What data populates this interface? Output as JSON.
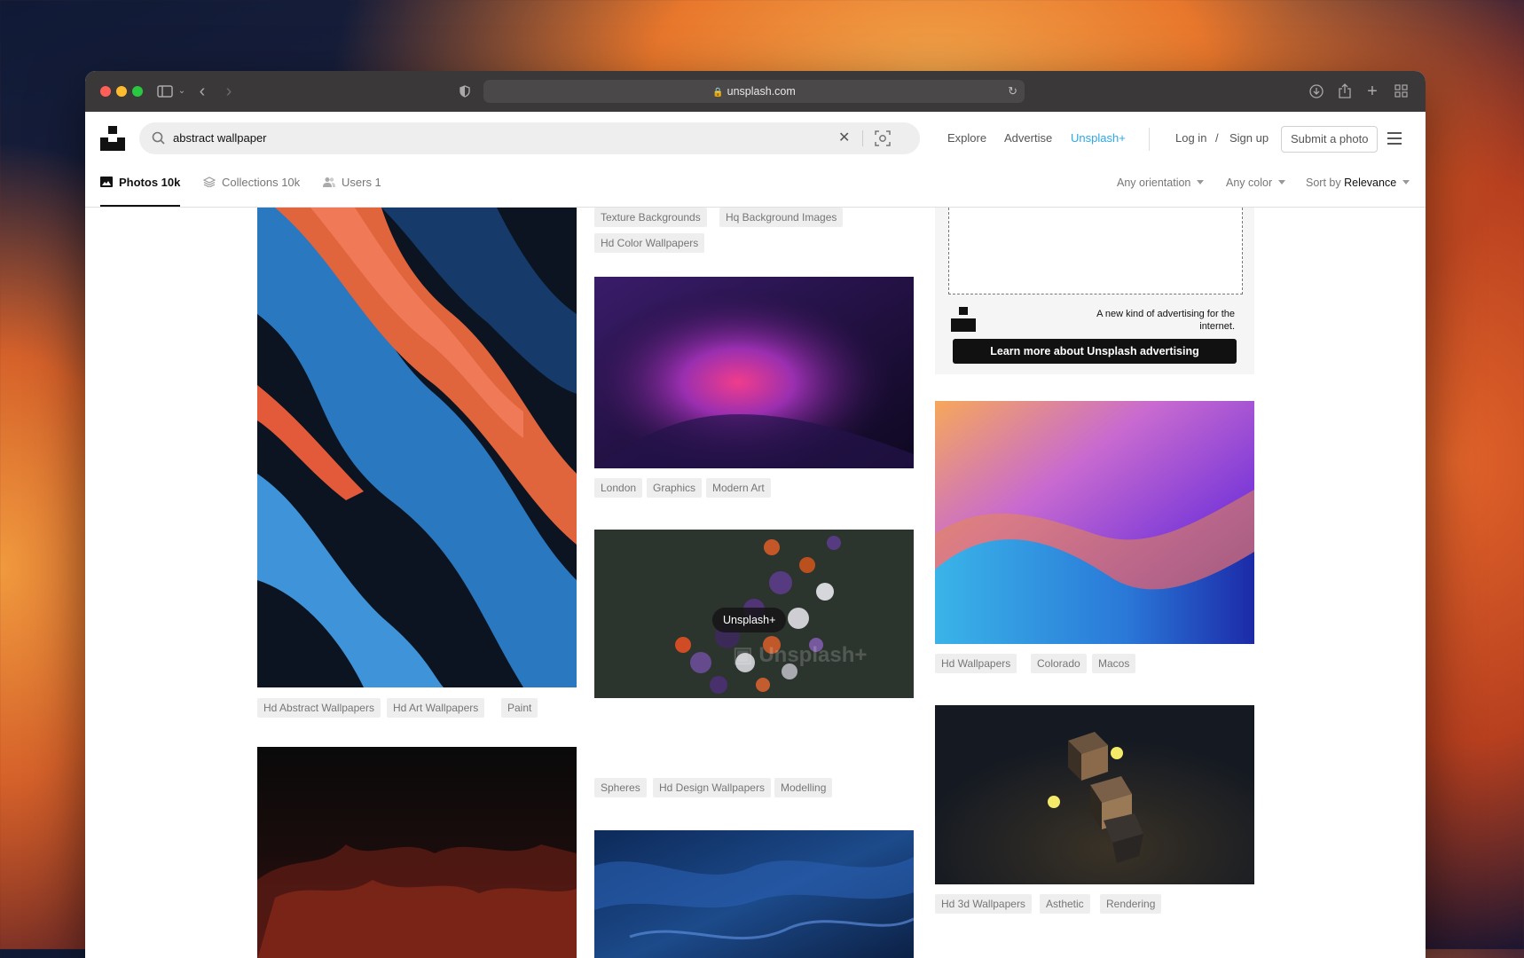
{
  "browser": {
    "url": "unsplash.com",
    "icons": [
      "sidebar-icon",
      "chevron-down-icon",
      "back-icon",
      "forward-icon",
      "shield-icon",
      "lock-icon",
      "reload-icon",
      "download-icon",
      "share-icon",
      "plus-icon",
      "tabs-grid-icon"
    ]
  },
  "header": {
    "search_value": "abstract wallpaper",
    "nav": {
      "explore": "Explore",
      "advertise": "Advertise",
      "unsplash_plus": "Unsplash+",
      "login": "Log in",
      "slash": "/",
      "signup": "Sign up",
      "submit": "Submit a photo"
    }
  },
  "tabs": [
    {
      "label": "Photos 10k"
    },
    {
      "label": "Collections 10k"
    },
    {
      "label": "Users 1"
    }
  ],
  "filters": {
    "orientation": "Any orientation",
    "color": "Any color",
    "sort_prefix": "Sort by",
    "sort_value": "Relevance"
  },
  "columns": {
    "col1": {
      "tags_1": [
        "Hd Abstract Wallpapers",
        "Hd Art Wallpapers",
        "Paint"
      ]
    },
    "col2": {
      "tags_top": [
        "Texture Backgrounds",
        "Hq Background Images",
        "Hd Color Wallpapers"
      ],
      "tags_1": [
        "London",
        "Graphics",
        "Modern Art"
      ],
      "badge": "Unsplash+",
      "tags_2": [
        "Spheres",
        "Hd Design Wallpapers",
        "Modelling"
      ]
    },
    "col3": {
      "ad_text": "A new kind of advertising for the internet.",
      "ad_button": "Learn more about Unsplash advertising",
      "tags_1": [
        "Hd Wallpapers",
        "Colorado",
        "Macos"
      ],
      "tags_2": [
        "Hd 3d Wallpapers",
        "Asthetic",
        "Rendering"
      ]
    }
  },
  "colors": {
    "accent_plus": "#2aa8ea",
    "tag_bg": "#eeeeee"
  }
}
